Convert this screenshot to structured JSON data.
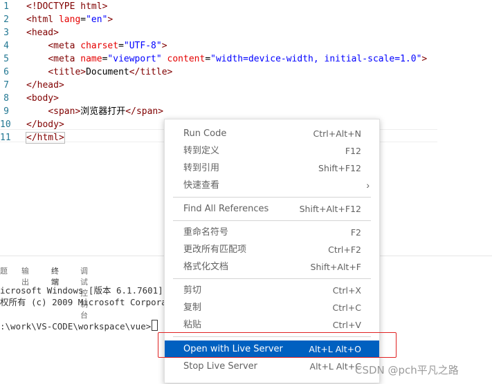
{
  "editor": {
    "line_numbers": [
      "1",
      "2",
      "3",
      "4",
      "5",
      "6",
      "7",
      "8",
      "9",
      "10",
      "11"
    ],
    "lines": [
      [
        {
          "c": "tag",
          "t": "<!DOCTYPE html>"
        }
      ],
      [
        {
          "c": "tag",
          "t": "<html "
        },
        {
          "c": "attr",
          "t": "lang"
        },
        {
          "c": "txt",
          "t": "="
        },
        {
          "c": "str",
          "t": "\"en\""
        },
        {
          "c": "tag",
          "t": ">"
        }
      ],
      [
        {
          "c": "tag",
          "t": "<head>"
        }
      ],
      [
        {
          "c": "txt",
          "t": "    "
        },
        {
          "c": "tag",
          "t": "<meta "
        },
        {
          "c": "attr",
          "t": "charset"
        },
        {
          "c": "txt",
          "t": "="
        },
        {
          "c": "str",
          "t": "\"UTF-8\""
        },
        {
          "c": "tag",
          "t": ">"
        }
      ],
      [
        {
          "c": "txt",
          "t": "    "
        },
        {
          "c": "tag",
          "t": "<meta "
        },
        {
          "c": "attr",
          "t": "name"
        },
        {
          "c": "txt",
          "t": "="
        },
        {
          "c": "str",
          "t": "\"viewport\""
        },
        {
          "c": "txt",
          "t": " "
        },
        {
          "c": "attr",
          "t": "content"
        },
        {
          "c": "txt",
          "t": "="
        },
        {
          "c": "str",
          "t": "\"width=device-width, initial-scale=1.0\""
        },
        {
          "c": "tag",
          "t": ">"
        }
      ],
      [
        {
          "c": "txt",
          "t": "    "
        },
        {
          "c": "tag",
          "t": "<title>"
        },
        {
          "c": "txt",
          "t": "Document"
        },
        {
          "c": "tag",
          "t": "</title>"
        }
      ],
      [
        {
          "c": "tag",
          "t": "</head>"
        }
      ],
      [
        {
          "c": "tag",
          "t": "<body>"
        }
      ],
      [
        {
          "c": "txt",
          "t": "    "
        },
        {
          "c": "tag",
          "t": "<span>"
        },
        {
          "c": "txt",
          "t": "浏览器打开"
        },
        {
          "c": "tag",
          "t": "</span>"
        }
      ],
      [
        {
          "c": "tag",
          "t": "</body>"
        }
      ],
      [
        {
          "c": "tag",
          "t": "</html>"
        }
      ]
    ]
  },
  "panel": {
    "tabs": [
      "题",
      "输出",
      "终端",
      "调试控制台"
    ],
    "active_tab": "终端",
    "terminal_lines": [
      "icrosoft Windows [版本 6.1.7601]",
      "权所有 (c) 2009 Microsoft Corporat",
      "",
      ":\\work\\VS-CODE\\workspace\\vue>"
    ]
  },
  "context_menu": {
    "items": [
      {
        "label": "Run Code",
        "shortcut": "Ctrl+Alt+N"
      },
      {
        "label": "转到定义",
        "shortcut": "F12"
      },
      {
        "label": "转到引用",
        "shortcut": "Shift+F12"
      },
      {
        "label": "快速查看",
        "shortcut": "",
        "submenu": true
      },
      {
        "label": "Find All References",
        "shortcut": "Shift+Alt+F12"
      },
      {
        "label": "重命名符号",
        "shortcut": "F2"
      },
      {
        "label": "更改所有匹配项",
        "shortcut": "Ctrl+F2"
      },
      {
        "label": "格式化文档",
        "shortcut": "Shift+Alt+F"
      },
      {
        "label": "剪切",
        "shortcut": "Ctrl+X"
      },
      {
        "label": "复制",
        "shortcut": "Ctrl+C"
      },
      {
        "label": "粘贴",
        "shortcut": "Ctrl+V"
      },
      {
        "label": "Open with Live Server",
        "shortcut": "Alt+L Alt+O",
        "highlighted": true
      },
      {
        "label": "Stop Live Server",
        "shortcut": "Alt+L Alt+C"
      }
    ]
  },
  "watermark": "CSDN @pch平凡之路",
  "colors": {
    "highlight": "#0060c0",
    "annotation_box": "#e02020",
    "line_number": "#237893",
    "tag": "#800000",
    "attribute": "#e50000",
    "string": "#0000ff"
  }
}
